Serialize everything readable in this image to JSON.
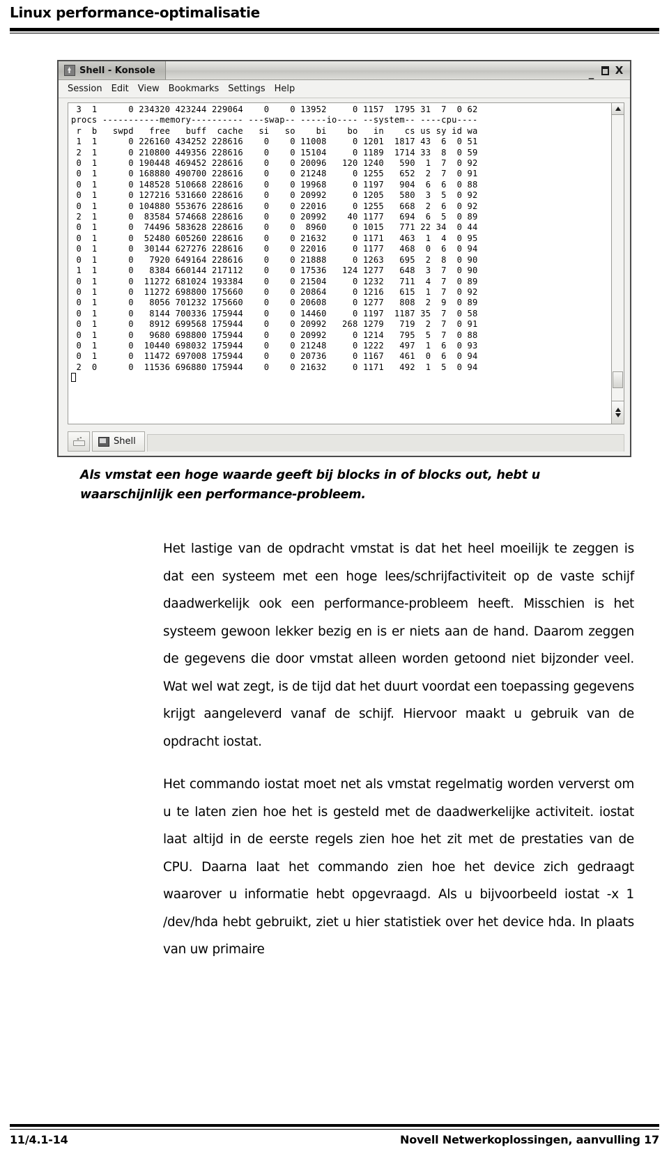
{
  "header": {
    "title": "Linux performance-optimalisatie"
  },
  "window": {
    "title": "Shell - Konsole",
    "icon": "konsole-icon",
    "buttons": {
      "minimize": "_",
      "maximize": "maximize",
      "close": "X"
    },
    "menu": [
      "Session",
      "Edit",
      "View",
      "Bookmarks",
      "Settings",
      "Help"
    ],
    "tabbar": {
      "new_tab_label": "new-session",
      "tabs": [
        {
          "label": "Shell",
          "icon": "terminal-icon"
        }
      ]
    },
    "terminal": {
      "lines": [
        " 3  1      0 234320 423244 229064    0    0 13952     0 1157  1795 31  7  0 62",
        "procs -----------memory---------- ---swap-- -----io---- --system-- ----cpu----",
        " r  b   swpd   free   buff  cache   si   so    bi    bo   in    cs us sy id wa",
        " 1  1      0 226160 434252 228616    0    0 11008     0 1201  1817 43  6  0 51",
        " 2  1      0 210800 449356 228616    0    0 15104     0 1189  1714 33  8  0 59",
        " 0  1      0 190448 469452 228616    0    0 20096   120 1240   590  1  7  0 92",
        " 0  1      0 168880 490700 228616    0    0 21248     0 1255   652  2  7  0 91",
        " 0  1      0 148528 510668 228616    0    0 19968     0 1197   904  6  6  0 88",
        " 0  1      0 127216 531660 228616    0    0 20992     0 1205   580  3  5  0 92",
        " 0  1      0 104880 553676 228616    0    0 22016     0 1255   668  2  6  0 92",
        " 2  1      0  83584 574668 228616    0    0 20992    40 1177   694  6  5  0 89",
        " 0  1      0  74496 583628 228616    0    0  8960     0 1015   771 22 34  0 44",
        " 0  1      0  52480 605260 228616    0    0 21632     0 1171   463  1  4  0 95",
        " 0  1      0  30144 627276 228616    0    0 22016     0 1177   468  0  6  0 94",
        " 0  1      0   7920 649164 228616    0    0 21888     0 1263   695  2  8  0 90",
        " 1  1      0   8384 660144 217112    0    0 17536   124 1277   648  3  7  0 90",
        " 0  1      0  11272 681024 193384    0    0 21504     0 1232   711  4  7  0 89",
        " 0  1      0  11272 698800 175660    0    0 20864     0 1216   615  1  7  0 92",
        " 0  1      0   8056 701232 175660    0    0 20608     0 1277   808  2  9  0 89",
        " 0  1      0   8144 700336 175944    0    0 14460     0 1197  1187 35  7  0 58",
        " 0  1      0   8912 699568 175944    0    0 20992   268 1279   719  2  7  0 91",
        " 0  1      0   9680 698800 175944    0    0 20992     0 1214   795  5  7  0 88",
        " 0  1      0  10440 698032 175944    0    0 21248     0 1222   497  1  6  0 93",
        " 0  1      0  11472 697008 175944    0    0 20736     0 1167   461  0  6  0 94",
        " 2  0      0  11536 696880 175944    0    0 21632     0 1171   492  1  5  0 94"
      ]
    }
  },
  "caption": {
    "text": "Als vmstat een hoge waarde geeft bij blocks in of blocks out, hebt u waarschijnlijk een performance-probleem."
  },
  "body": {
    "paragraphs": [
      "Het lastige van de opdracht vmstat is dat het heel moeilijk te zeggen is dat een systeem met een hoge lees/schrijfactiviteit op de vaste schijf daadwerkelijk ook een performance-probleem heeft. Misschien is het systeem gewoon lekker bezig en is er niets aan de hand. Daarom zeggen de gegevens die door vmstat alleen worden getoond niet bijzonder veel. Wat wel wat zegt, is de tijd dat het duurt voordat een toepassing gegevens krijgt aangeleverd vanaf de schijf. Hiervoor maakt u gebruik van de opdracht iostat.",
      "Het commando iostat moet net als vmstat regelmatig worden ververst om u te laten zien hoe het is gesteld met de daadwerkelijke activiteit. iostat laat altijd in de eerste regels zien hoe het zit met de prestaties van de CPU. Daarna laat het commando zien hoe het device zich gedraagt waarover u informatie hebt opgevraagd. Als u bijvoorbeeld iostat -x 1 /dev/hda hebt gebruikt, ziet u hier statistiek over het device hda. In plaats van uw primaire"
    ]
  },
  "footer": {
    "left": "11/4.1-14",
    "right": "Novell Netwerkoplossingen, aanvulling 17"
  }
}
